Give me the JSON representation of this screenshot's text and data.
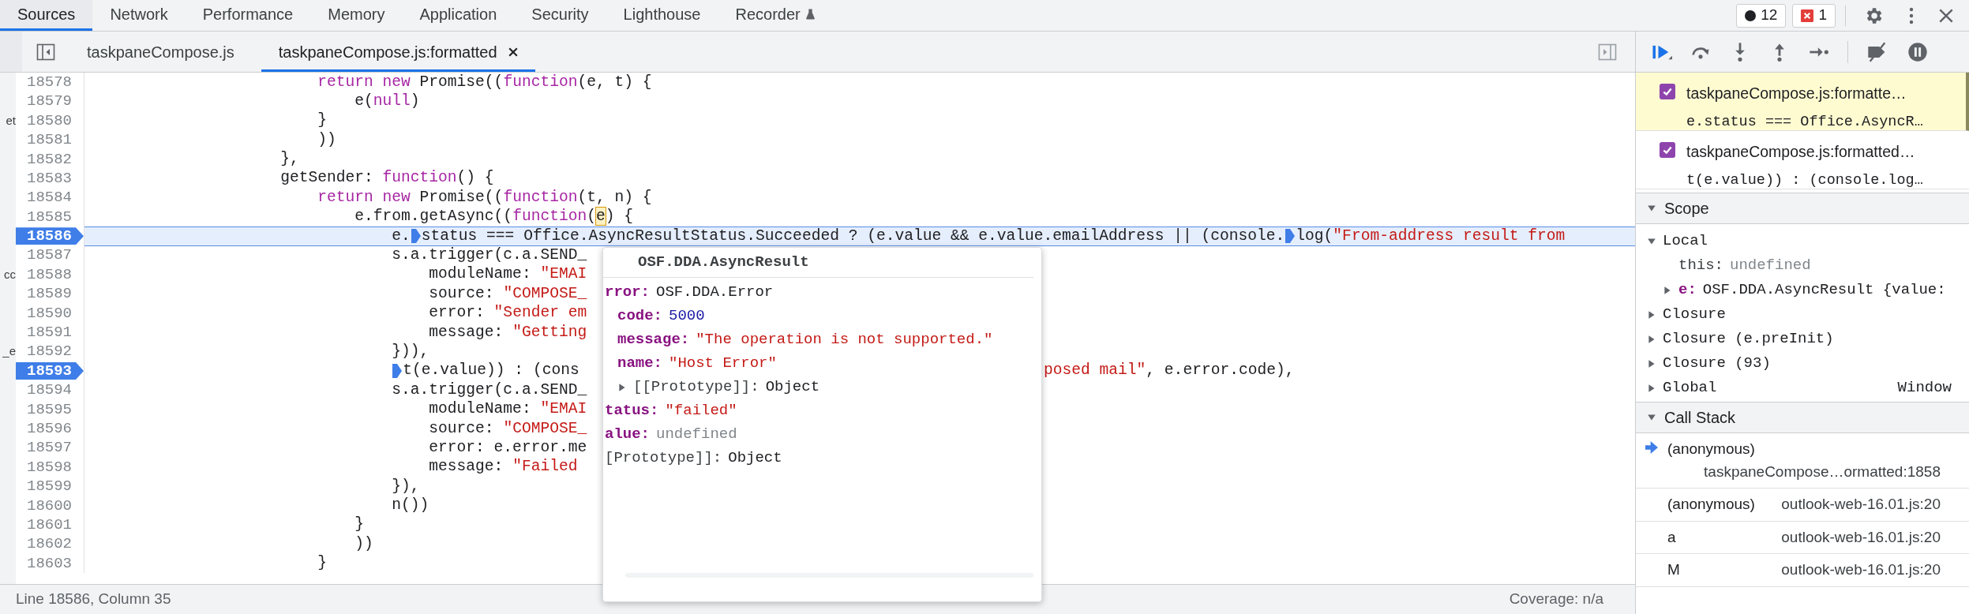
{
  "top_tabs": [
    {
      "label": "Sources",
      "selected": true,
      "experimental": false
    },
    {
      "label": "Network",
      "selected": false,
      "experimental": false
    },
    {
      "label": "Performance",
      "selected": false,
      "experimental": false
    },
    {
      "label": "Memory",
      "selected": false,
      "experimental": false
    },
    {
      "label": "Application",
      "selected": false,
      "experimental": false
    },
    {
      "label": "Security",
      "selected": false,
      "experimental": false
    },
    {
      "label": "Lighthouse",
      "selected": false,
      "experimental": false
    },
    {
      "label": "Recorder",
      "selected": false,
      "experimental": true
    }
  ],
  "counters": [
    {
      "kind": "issues",
      "count": "12"
    },
    {
      "kind": "errors",
      "count": "1"
    }
  ],
  "file_tabs": [
    {
      "label": "taskpaneCompose.js",
      "selected": false,
      "closable": false
    },
    {
      "label": "taskpaneCompose.js:formatted",
      "selected": true,
      "closable": true
    }
  ],
  "code": {
    "lines": [
      {
        "number": "18578",
        "breakpoint": false,
        "current": false,
        "segments": [
          {
            "marker": false,
            "tokens": [
              {
                "kind": "keyword",
                "text": "                        return new"
              },
              {
                "kind": "plain",
                "text": " Promise(("
              },
              {
                "kind": "keyword",
                "text": "function"
              },
              {
                "kind": "plain",
                "text": "(e, t) {"
              }
            ]
          }
        ]
      },
      {
        "number": "18579",
        "breakpoint": false,
        "current": false,
        "segments": [
          {
            "marker": false,
            "tokens": [
              {
                "kind": "plain",
                "text": "                            e("
              },
              {
                "kind": "keyword",
                "text": "null"
              },
              {
                "kind": "plain",
                "text": ")"
              }
            ]
          }
        ]
      },
      {
        "number": "18580",
        "breakpoint": false,
        "current": false,
        "margin_text": "et",
        "segments": [
          {
            "marker": false,
            "tokens": [
              {
                "kind": "plain",
                "text": "                        }"
              }
            ]
          }
        ]
      },
      {
        "number": "18581",
        "breakpoint": false,
        "current": false,
        "segments": [
          {
            "marker": false,
            "tokens": [
              {
                "kind": "plain",
                "text": "                        ))"
              }
            ]
          }
        ]
      },
      {
        "number": "18582",
        "breakpoint": false,
        "current": false,
        "segments": [
          {
            "marker": false,
            "tokens": [
              {
                "kind": "plain",
                "text": "                    },"
              }
            ]
          }
        ]
      },
      {
        "number": "18583",
        "breakpoint": false,
        "current": false,
        "segments": [
          {
            "marker": false,
            "tokens": [
              {
                "kind": "plain",
                "text": "                    getSender: "
              },
              {
                "kind": "keyword",
                "text": "function"
              },
              {
                "kind": "plain",
                "text": "() {"
              }
            ]
          }
        ]
      },
      {
        "number": "18584",
        "breakpoint": false,
        "current": false,
        "segments": [
          {
            "marker": false,
            "tokens": [
              {
                "kind": "keyword",
                "text": "                        return new"
              },
              {
                "kind": "plain",
                "text": " Promise(("
              },
              {
                "kind": "keyword",
                "text": "function"
              },
              {
                "kind": "plain",
                "text": "(t, n) {"
              }
            ]
          }
        ]
      },
      {
        "number": "18585",
        "breakpoint": false,
        "current": false,
        "segments": [
          {
            "marker": false,
            "tokens": [
              {
                "kind": "plain",
                "text": "                            e.from.getAsync(("
              },
              {
                "kind": "keyword",
                "text": "function"
              },
              {
                "kind": "plain",
                "text": "("
              },
              {
                "kind": "highlight",
                "text": "e"
              },
              {
                "kind": "plain",
                "text": ") {"
              }
            ]
          }
        ]
      },
      {
        "number": "18586",
        "breakpoint": true,
        "current": true,
        "segments": [
          {
            "marker": false,
            "tokens": [
              {
                "kind": "plain",
                "text": "                                e."
              }
            ]
          },
          {
            "marker": true,
            "tokens": [
              {
                "kind": "plain",
                "text": "status === Office.AsyncResultStatus.Succeeded ? (e.value && e.value.emailAddress || (console."
              }
            ]
          },
          {
            "marker": true,
            "tokens": [
              {
                "kind": "plain",
                "text": "log("
              },
              {
                "kind": "string",
                "text": "\"From-address result from"
              }
            ]
          }
        ]
      },
      {
        "number": "18587",
        "breakpoint": false,
        "current": false,
        "segments": [
          {
            "marker": false,
            "tokens": [
              {
                "kind": "plain",
                "text": "                                s.a.trigger(c.a.SEND_"
              }
            ]
          }
        ]
      },
      {
        "number": "18588",
        "breakpoint": false,
        "current": false,
        "margin_text": "cc",
        "segments": [
          {
            "marker": false,
            "tokens": [
              {
                "kind": "plain",
                "text": "                                    moduleName: "
              },
              {
                "kind": "string",
                "text": "\"EMAI"
              }
            ]
          }
        ]
      },
      {
        "number": "18589",
        "breakpoint": false,
        "current": false,
        "segments": [
          {
            "marker": false,
            "tokens": [
              {
                "kind": "plain",
                "text": "                                    source: "
              },
              {
                "kind": "string",
                "text": "\"COMPOSE_"
              }
            ]
          }
        ]
      },
      {
        "number": "18590",
        "breakpoint": false,
        "current": false,
        "segments": [
          {
            "marker": false,
            "tokens": [
              {
                "kind": "plain",
                "text": "                                    error: "
              },
              {
                "kind": "string",
                "text": "\"Sender em"
              }
            ]
          }
        ]
      },
      {
        "number": "18591",
        "breakpoint": false,
        "current": false,
        "segments": [
          {
            "marker": false,
            "tokens": [
              {
                "kind": "plain",
                "text": "                                    message: "
              },
              {
                "kind": "string",
                "text": "\"Getting"
              }
            ]
          }
        ]
      },
      {
        "number": "18592",
        "breakpoint": false,
        "current": false,
        "margin_text": "_e",
        "segments": [
          {
            "marker": false,
            "tokens": [
              {
                "kind": "plain",
                "text": "                                })),"
              }
            ]
          }
        ]
      },
      {
        "number": "18593",
        "breakpoint": true,
        "current": false,
        "segments": [
          {
            "marker": true,
            "tokens": [
              {
                "kind": "plain",
                "text": "                                t(e.value)) : (cons"
              }
            ]
          }
        ],
        "tail": [
          {
            "kind": "string",
            "text": "posed mail\""
          },
          {
            "kind": "plain",
            "text": ", e.error.code),"
          }
        ]
      },
      {
        "number": "18594",
        "breakpoint": false,
        "current": false,
        "segments": [
          {
            "marker": false,
            "tokens": [
              {
                "kind": "plain",
                "text": "                                s.a.trigger(c.a.SEND_"
              }
            ]
          }
        ]
      },
      {
        "number": "18595",
        "breakpoint": false,
        "current": false,
        "segments": [
          {
            "marker": false,
            "tokens": [
              {
                "kind": "plain",
                "text": "                                    moduleName: "
              },
              {
                "kind": "string",
                "text": "\"EMAI"
              }
            ]
          }
        ]
      },
      {
        "number": "18596",
        "breakpoint": false,
        "current": false,
        "segments": [
          {
            "marker": false,
            "tokens": [
              {
                "kind": "plain",
                "text": "                                    source: "
              },
              {
                "kind": "string",
                "text": "\"COMPOSE_"
              }
            ]
          }
        ]
      },
      {
        "number": "18597",
        "breakpoint": false,
        "current": false,
        "segments": [
          {
            "marker": false,
            "tokens": [
              {
                "kind": "plain",
                "text": "                                    error: e.error.me"
              }
            ]
          }
        ]
      },
      {
        "number": "18598",
        "breakpoint": false,
        "current": false,
        "segments": [
          {
            "marker": false,
            "tokens": [
              {
                "kind": "plain",
                "text": "                                    message: "
              },
              {
                "kind": "string",
                "text": "\"Failed"
              }
            ]
          }
        ]
      },
      {
        "number": "18599",
        "breakpoint": false,
        "current": false,
        "segments": [
          {
            "marker": false,
            "tokens": [
              {
                "kind": "plain",
                "text": "                                }),"
              }
            ]
          }
        ]
      },
      {
        "number": "18600",
        "breakpoint": false,
        "current": false,
        "segments": [
          {
            "marker": false,
            "tokens": [
              {
                "kind": "plain",
                "text": "                                n())"
              }
            ]
          }
        ]
      },
      {
        "number": "18601",
        "breakpoint": false,
        "current": false,
        "segments": [
          {
            "marker": false,
            "tokens": [
              {
                "kind": "plain",
                "text": "                            }"
              }
            ]
          }
        ]
      },
      {
        "number": "18602",
        "breakpoint": false,
        "current": false,
        "segments": [
          {
            "marker": false,
            "tokens": [
              {
                "kind": "plain",
                "text": "                            ))"
              }
            ]
          }
        ]
      },
      {
        "number": "18603",
        "breakpoint": false,
        "current": false,
        "segments": [
          {
            "marker": false,
            "tokens": [
              {
                "kind": "plain",
                "text": "                        }"
              }
            ]
          }
        ]
      }
    ]
  },
  "popover": {
    "title": "OSF.DDA.AsyncResult",
    "properties": [
      {
        "key": "rror:",
        "value": "OSF.DDA.Error",
        "kind": "object",
        "children": [
          {
            "key": "code:",
            "value": "5000",
            "kind": "number"
          },
          {
            "key": "message:",
            "value": "\"The operation is not supported.\"",
            "kind": "string"
          },
          {
            "key": "name:",
            "value": "\"Host Error\"",
            "kind": "string"
          },
          {
            "key": "[[Prototype]]:",
            "value": "Object",
            "kind": "object",
            "internal": true,
            "expanded": false
          }
        ]
      },
      {
        "key": "tatus:",
        "value": "\"failed\"",
        "kind": "string"
      },
      {
        "key": "alue:",
        "value": "undefined",
        "kind": "undefined"
      },
      {
        "key": "[Prototype]]:",
        "value": "Object",
        "kind": "object",
        "internal": true
      }
    ]
  },
  "status_bar": {
    "position": "Line 18586, Column 35",
    "coverage": "Coverage: n/a"
  },
  "breakpoints": [
    {
      "file": "taskpaneCompose.js:formatte…",
      "code": "e.status === Office.AsyncR…",
      "checked": true,
      "hit": true
    },
    {
      "file": "taskpaneCompose.js:formatted…",
      "code": "t(e.value)) : (console.log…",
      "checked": true,
      "hit": false
    }
  ],
  "scope": {
    "title": "Scope",
    "expanded": true,
    "sections": [
      {
        "name": "Local",
        "expanded": true,
        "variables": [
          {
            "key": "this:",
            "value": "undefined",
            "kind": "undefined",
            "expandable": false,
            "internal": true
          },
          {
            "key": "e:",
            "value": "OSF.DDA.AsyncResult {value:",
            "kind": "object",
            "expandable": true
          }
        ]
      },
      {
        "name": "Closure",
        "expanded": false
      },
      {
        "name": "Closure (e.preInit)",
        "expanded": false
      },
      {
        "name": "Closure (93)",
        "expanded": false
      },
      {
        "name": "Global",
        "expanded": false,
        "value": "Window"
      }
    ]
  },
  "call_stack": {
    "title": "Call Stack",
    "expanded": true,
    "frames": [
      {
        "name": "(anonymous)",
        "location": "taskpaneCompose…ormatted:1858",
        "selected": true
      },
      {
        "name": "(anonymous)",
        "location": "outlook-web-16.01.js:20",
        "selected": false
      },
      {
        "name": "a",
        "location": "outlook-web-16.01.js:20",
        "selected": false
      },
      {
        "name": "M",
        "location": "outlook-web-16.01.js:20",
        "selected": false
      }
    ]
  }
}
